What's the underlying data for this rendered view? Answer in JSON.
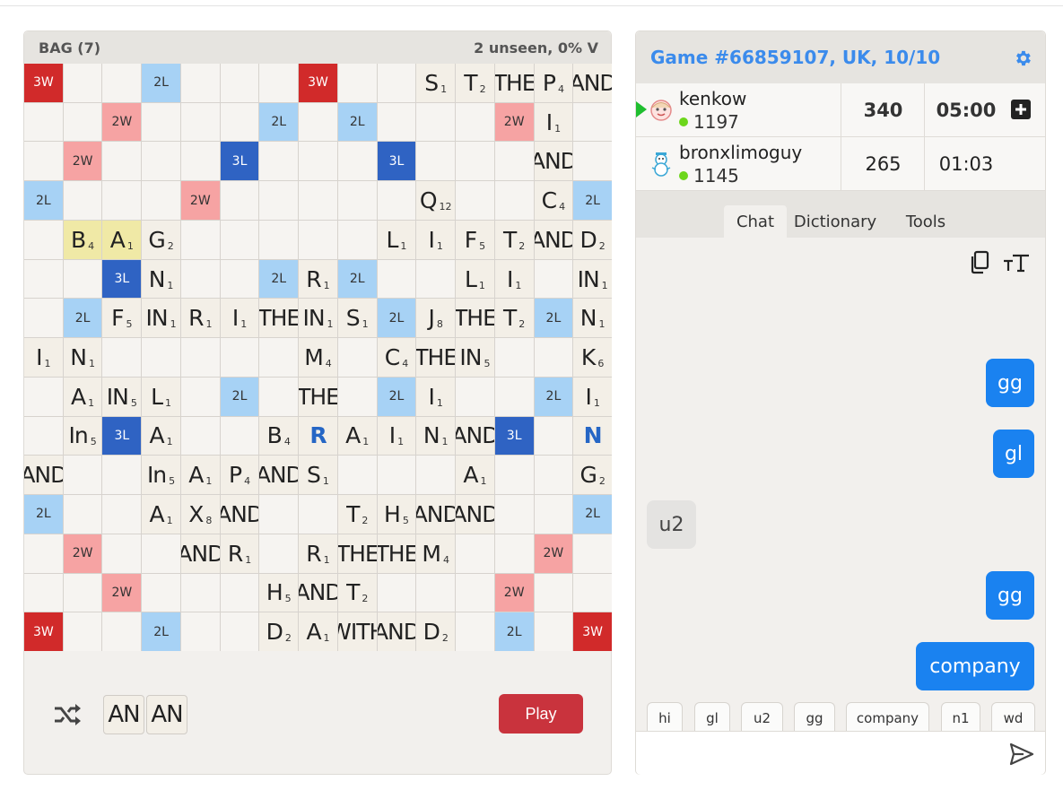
{
  "bag": {
    "label": "BAG (7)",
    "stats": "2 unseen, 0% V"
  },
  "board": {
    "rows": [
      [
        {
          "b": "3W"
        },
        {},
        {},
        {
          "b": "2L"
        },
        {},
        {},
        {},
        {
          "b": "3W"
        },
        {},
        {},
        {
          "l": "S",
          "p": "1"
        },
        {
          "l": "T",
          "p": "2"
        },
        {
          "l": "THE"
        },
        {
          "l": "P",
          "p": "4"
        },
        {
          "l": "AND"
        }
      ],
      [
        {},
        {},
        {
          "b": "2W"
        },
        {},
        {},
        {},
        {
          "b": "2L"
        },
        {},
        {
          "b": "2L"
        },
        {},
        {},
        {},
        {
          "b": "2W"
        },
        {
          "l": "I",
          "p": "1"
        },
        {}
      ],
      [
        {},
        {
          "b": "2W"
        },
        {},
        {},
        {},
        {
          "b": "3L"
        },
        {},
        {},
        {},
        {
          "b": "3L"
        },
        {},
        {},
        {},
        {
          "l": "AND"
        },
        {}
      ],
      [
        {
          "b": "2L"
        },
        {},
        {},
        {},
        {
          "b": "2W"
        },
        {},
        {},
        {},
        {},
        {},
        {
          "l": "Q",
          "p": "12"
        },
        {},
        {},
        {
          "l": "C",
          "p": "4"
        },
        {
          "b": "2L"
        }
      ],
      [
        {},
        {
          "l": "B",
          "p": "4",
          "last": true
        },
        {
          "l": "A",
          "p": "1",
          "last": true
        },
        {
          "l": "G",
          "p": "2"
        },
        {},
        {},
        {},
        {},
        {},
        {
          "l": "L",
          "p": "1"
        },
        {
          "l": "I",
          "p": "1"
        },
        {
          "l": "F",
          "p": "5"
        },
        {
          "l": "T",
          "p": "2"
        },
        {
          "l": "AND"
        },
        {
          "l": "D",
          "p": "2"
        }
      ],
      [
        {},
        {},
        {
          "b": "3L"
        },
        {
          "l": "N",
          "p": "1"
        },
        {},
        {},
        {
          "b": "2L"
        },
        {
          "l": "R",
          "p": "1"
        },
        {
          "b": "2L"
        },
        {},
        {},
        {
          "l": "L",
          "p": "1"
        },
        {
          "l": "I",
          "p": "1"
        },
        {},
        {
          "l": "IN",
          "p": "1"
        }
      ],
      [
        {},
        {
          "b": "2L"
        },
        {
          "l": "F",
          "p": "5"
        },
        {
          "l": "IN",
          "p": "1"
        },
        {
          "l": "R",
          "p": "1"
        },
        {
          "l": "I",
          "p": "1"
        },
        {
          "l": "THE"
        },
        {
          "l": "IN",
          "p": "1"
        },
        {
          "l": "S",
          "p": "1"
        },
        {
          "b": "2L"
        },
        {
          "l": "J",
          "p": "8"
        },
        {
          "l": "THE"
        },
        {
          "l": "T",
          "p": "2"
        },
        {
          "b": "2L"
        },
        {
          "l": "N",
          "p": "1"
        }
      ],
      [
        {
          "l": "I",
          "p": "1"
        },
        {
          "l": "N",
          "p": "1"
        },
        {},
        {},
        {},
        {},
        {},
        {
          "l": "M",
          "p": "4"
        },
        {},
        {
          "l": "C",
          "p": "4"
        },
        {
          "l": "THE"
        },
        {
          "l": "IN",
          "p": "5"
        },
        {},
        {},
        {
          "l": "K",
          "p": "6"
        }
      ],
      [
        {},
        {
          "l": "A",
          "p": "1"
        },
        {
          "l": "IN",
          "p": "5"
        },
        {
          "l": "L",
          "p": "1"
        },
        {},
        {
          "b": "2L"
        },
        {},
        {
          "l": "THE"
        },
        {},
        {
          "b": "2L"
        },
        {
          "l": "I",
          "p": "1"
        },
        {},
        {},
        {
          "b": "2L"
        },
        {
          "l": "I",
          "p": "1"
        }
      ],
      [
        {},
        {
          "l": "In",
          "p": "5"
        },
        {
          "b": "3L"
        },
        {
          "l": "A",
          "p": "1"
        },
        {},
        {},
        {
          "l": "B",
          "p": "4"
        },
        {
          "l": "R",
          "blank": true
        },
        {
          "l": "A",
          "p": "1"
        },
        {
          "l": "I",
          "p": "1"
        },
        {
          "l": "N",
          "p": "1"
        },
        {
          "l": "AND"
        },
        {
          "b": "3L"
        },
        {},
        {
          "l": "N",
          "blank": true
        }
      ],
      [
        {
          "l": "AND"
        },
        {},
        {},
        {
          "l": "In",
          "p": "5"
        },
        {
          "l": "A",
          "p": "1"
        },
        {
          "l": "P",
          "p": "4"
        },
        {
          "l": "AND"
        },
        {
          "l": "S",
          "p": "1"
        },
        {},
        {},
        {},
        {
          "l": "A",
          "p": "1"
        },
        {},
        {},
        {
          "l": "G",
          "p": "2"
        }
      ],
      [
        {
          "b": "2L"
        },
        {},
        {},
        {
          "l": "A",
          "p": "1"
        },
        {
          "l": "X",
          "p": "8"
        },
        {
          "l": "AND"
        },
        {},
        {},
        {
          "l": "T",
          "p": "2"
        },
        {
          "l": "H",
          "p": "5"
        },
        {
          "l": "AND"
        },
        {
          "l": "AND"
        },
        {},
        {},
        {
          "b": "2L"
        }
      ],
      [
        {},
        {
          "b": "2W"
        },
        {},
        {},
        {
          "l": "AND"
        },
        {
          "l": "R",
          "p": "1"
        },
        {},
        {
          "l": "R",
          "p": "1"
        },
        {
          "l": "THE"
        },
        {
          "l": "THE"
        },
        {
          "l": "M",
          "p": "4"
        },
        {},
        {},
        {
          "b": "2W"
        },
        {}
      ],
      [
        {},
        {},
        {
          "b": "2W"
        },
        {},
        {},
        {},
        {
          "l": "H",
          "p": "5"
        },
        {
          "l": "AND"
        },
        {
          "l": "T",
          "p": "2"
        },
        {},
        {},
        {},
        {
          "b": "2W"
        },
        {},
        {}
      ],
      [
        {
          "b": "3W"
        },
        {},
        {},
        {
          "b": "2L"
        },
        {},
        {},
        {
          "l": "D",
          "p": "2"
        },
        {
          "l": "A",
          "p": "1"
        },
        {
          "l": "WITH"
        },
        {
          "l": "AND"
        },
        {
          "l": "D",
          "p": "2"
        },
        {},
        {
          "b": "2L"
        },
        {},
        {
          "b": "3W"
        }
      ]
    ]
  },
  "rack": {
    "tiles": [
      "AN",
      "AN"
    ],
    "shuffle_icon": "shuffle-icon"
  },
  "play_label": "Play",
  "game": {
    "title": "Game #66859107, UK, 10/10",
    "settings_icon": "gear-icon"
  },
  "players": [
    {
      "name": "kenkow",
      "rating": "1197",
      "score": "340",
      "time": "05:00",
      "avatar": "face-avatar-icon",
      "active": true
    },
    {
      "name": "bronxlimoguy",
      "rating": "1145",
      "score": "265",
      "time": "01:03",
      "avatar": "snowman-avatar-icon",
      "active": false
    }
  ],
  "tabs": [
    "Chat",
    "Dictionary",
    "Tools"
  ],
  "chat": {
    "messages": [
      {
        "text": "gg",
        "mine": true
      },
      {
        "text": "gl",
        "mine": true
      },
      {
        "text": "u2",
        "mine": false
      },
      {
        "text": "gg",
        "mine": true
      },
      {
        "text": "company",
        "mine": true
      }
    ],
    "quick_replies": [
      "hi",
      "gl",
      "u2",
      "gg",
      "company",
      "n1",
      "wd"
    ],
    "input_placeholder": ""
  },
  "colors": {
    "accent": "#3b8bec",
    "play": "#c9333d",
    "chat_bubble": "#1a82f0",
    "tw": "#d12a2a",
    "dw": "#f6a3a3",
    "tl": "#2f63c3",
    "dl": "#a7d2f5"
  }
}
